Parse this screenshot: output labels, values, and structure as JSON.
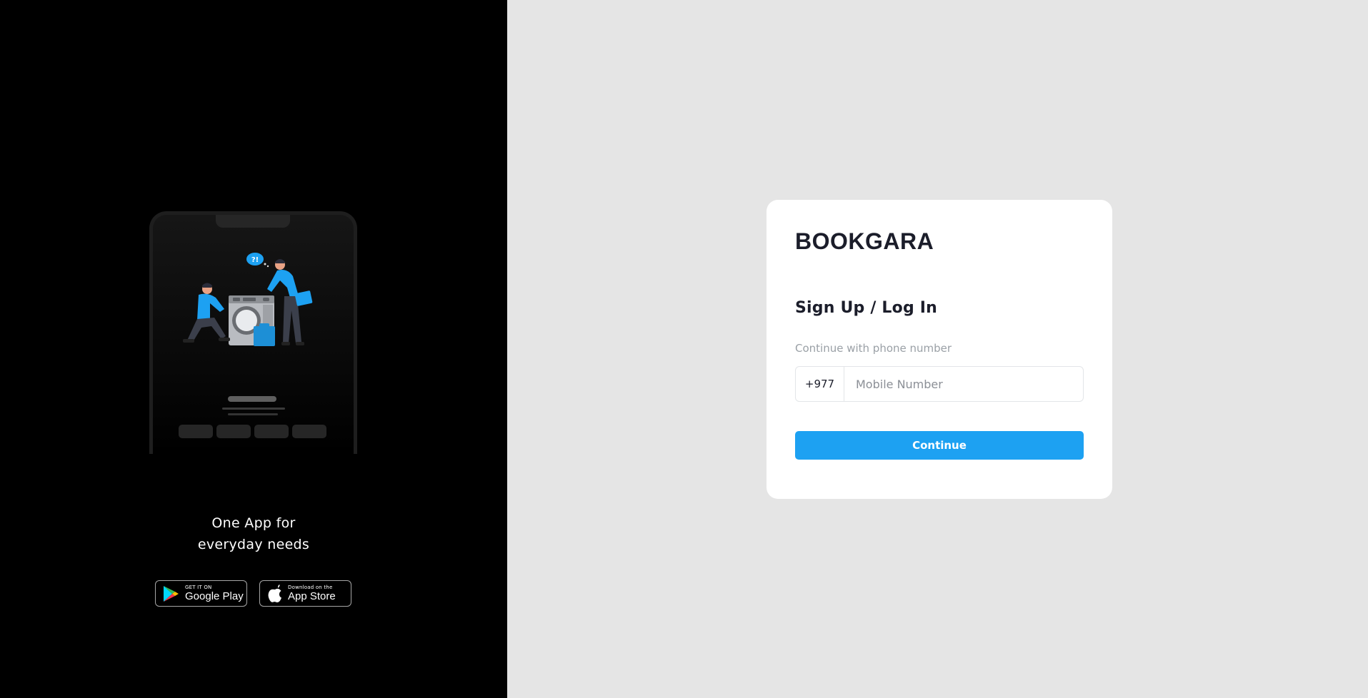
{
  "brand": {
    "name": "BOOKGARA"
  },
  "promo": {
    "tagline_line1": "One App for",
    "tagline_line2": "everyday needs",
    "speech_bubble": "?!",
    "google_play": {
      "small": "GET IT ON",
      "big": "Google Play",
      "icon": "google-play-icon"
    },
    "app_store": {
      "small": "Download on the",
      "big": "App Store",
      "icon": "apple-icon"
    }
  },
  "auth": {
    "title": "Sign Up / Log In",
    "subtitle": "Continue with phone number",
    "country_code": "+977",
    "mobile_placeholder": "Mobile Number",
    "mobile_value": "",
    "continue_label": "Continue"
  },
  "colors": {
    "left_bg": "#000000",
    "right_bg": "#e5e5e5",
    "accent": "#1da1f2",
    "text_dark": "#1b1d2a",
    "text_muted": "#9aa0a6"
  }
}
